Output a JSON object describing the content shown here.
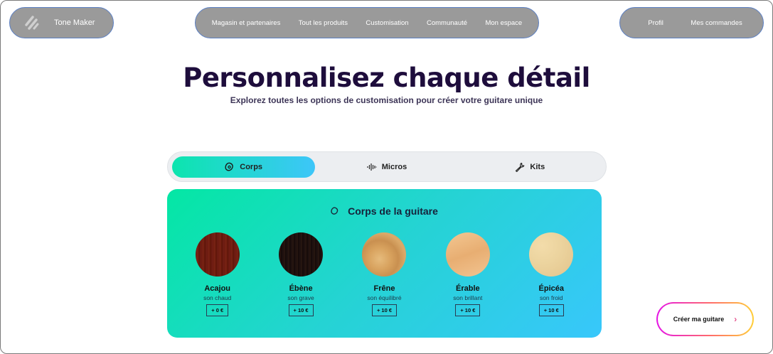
{
  "header": {
    "brand": "Tone Maker",
    "nav": [
      "Magasin et partenaires",
      "Tout les produits",
      "Customisation",
      "Communauté",
      "Mon espace"
    ],
    "account": [
      "Profil",
      "Mes commandes"
    ]
  },
  "hero": {
    "title": "Personnalisez chaque détail",
    "subtitle": "Explorez toutes les options de customisation pour créer votre guitare unique"
  },
  "tabs": [
    {
      "label": "Corps",
      "icon": "guitar-body-icon",
      "active": true
    },
    {
      "label": "Micros",
      "icon": "waveform-icon",
      "active": false
    },
    {
      "label": "Kits",
      "icon": "wrench-icon",
      "active": false
    }
  ],
  "panel": {
    "title": "Corps de la guitare",
    "woods": [
      {
        "name": "Acajou",
        "desc": "son chaud",
        "price": "+ 0 €"
      },
      {
        "name": "Ébène",
        "desc": "son grave",
        "price": "+ 10 €"
      },
      {
        "name": "Frêne",
        "desc": "son équilibré",
        "price": "+ 10 €"
      },
      {
        "name": "Érable",
        "desc": "son brillant",
        "price": "+ 10 €"
      },
      {
        "name": "Épicéa",
        "desc": "son froid",
        "price": "+ 10 €"
      }
    ]
  },
  "cta": {
    "label": "Créer ma guitare"
  },
  "colors": {
    "title": "#1e0d3c",
    "accent_start": "#04e7a4",
    "accent_end": "#38c7fb",
    "nav_bg": "#9a9a9a"
  }
}
